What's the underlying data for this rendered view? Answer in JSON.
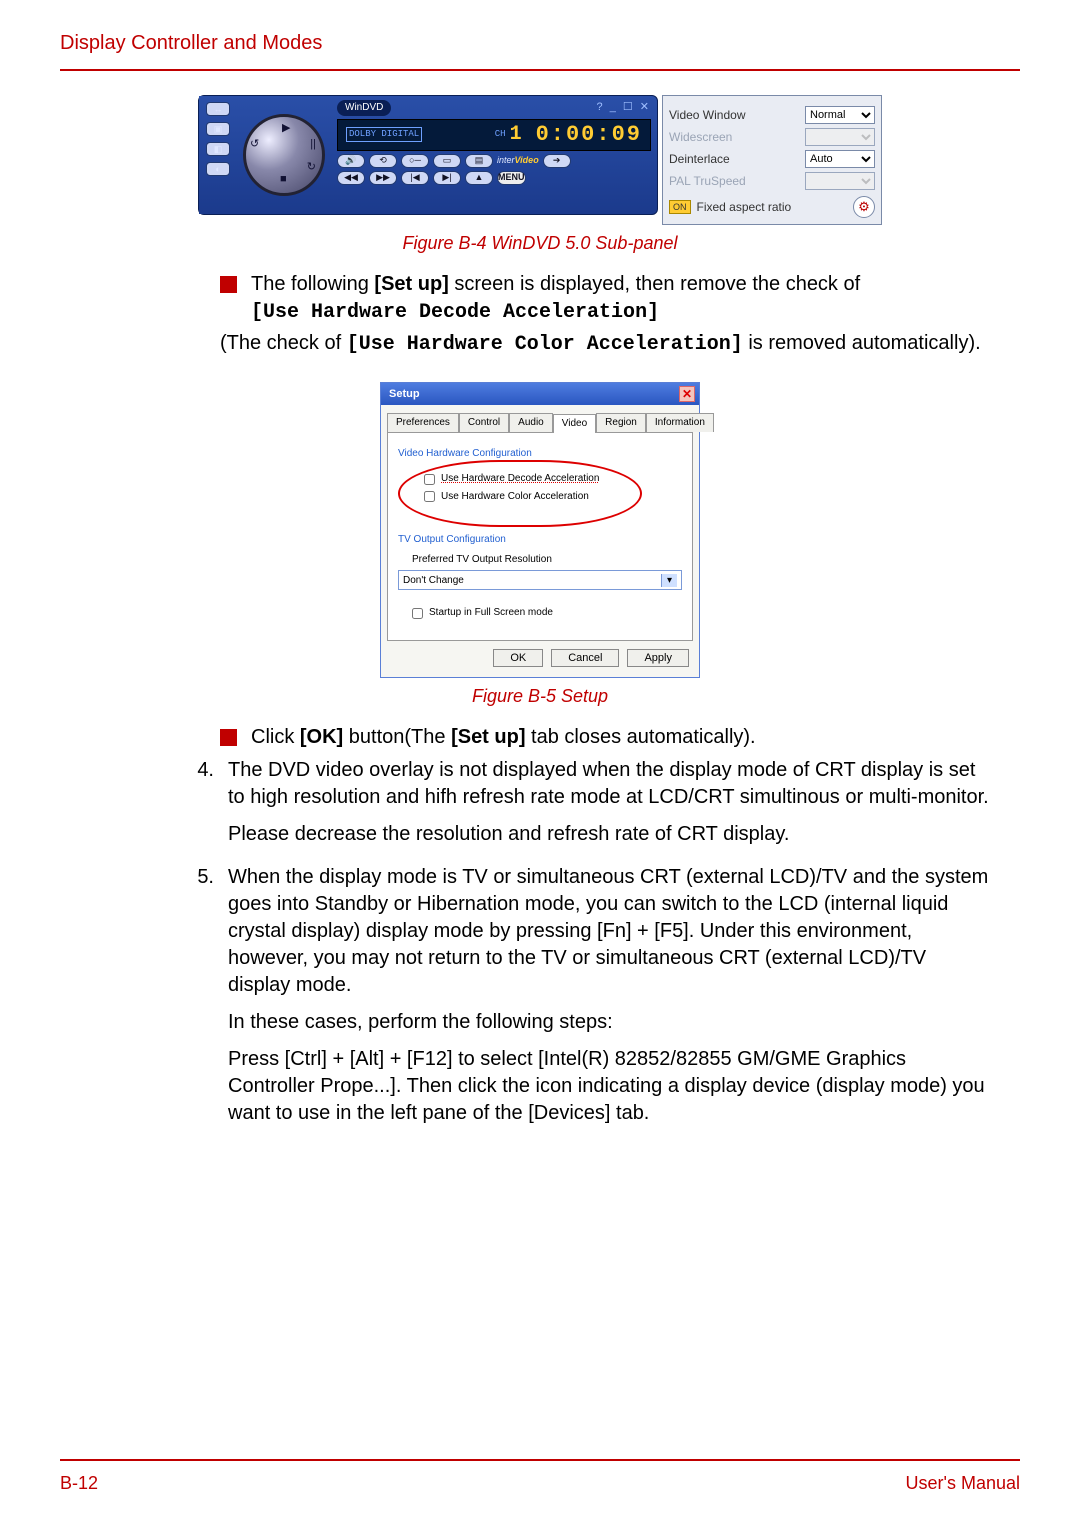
{
  "header": {
    "title": "Display Controller and Modes"
  },
  "windvd": {
    "brand": "WinDVD",
    "title_icons": "? _ ☐ ✕",
    "dolby": "DOLBY DIGITAL",
    "ch_label": "CH",
    "ch_num": "1",
    "time": "0:00:09",
    "intervideo_pre": "inter",
    "intervideo_bold": "Video",
    "menu_label": "MENU",
    "row1": [
      "⟲",
      "○─",
      "▭",
      "▤"
    ],
    "row2": [
      "◀◀",
      "▶▶",
      "|◀",
      "▶|",
      "▲"
    ],
    "dial_marks": [
      "▶",
      "||",
      "■",
      "↺",
      "↻"
    ],
    "side": [
      "↔",
      "▣",
      "◧",
      "◐"
    ]
  },
  "settings": {
    "rows": [
      {
        "label": "Video Window",
        "value": "Normal",
        "disabled": false
      },
      {
        "label": "Widescreen",
        "value": "",
        "disabled": true
      },
      {
        "label": "Deinterlace",
        "value": "Auto",
        "disabled": false
      },
      {
        "label": "PAL TruSpeed",
        "value": "",
        "disabled": true
      }
    ],
    "aspect_on": "ON",
    "aspect_label": "Fixed aspect ratio",
    "gear": "⚙"
  },
  "figcap1": "Figure B-4 WinDVD 5.0 Sub-panel",
  "para1": {
    "pre": "The following ",
    "bold1": "[Set up]",
    "mid": " screen is displayed, then remove the check of ",
    "mono": "[Use Hardware Decode Acceleration]"
  },
  "para2": {
    "pre": "(The check of ",
    "mono": "[Use Hardware Color Acceleration]",
    "post": " is removed automatically)."
  },
  "setup": {
    "title": "Setup",
    "tabs": [
      "Preferences",
      "Control",
      "Audio",
      "Video",
      "Region",
      "Information"
    ],
    "active_tab_index": 3,
    "vhc_label": "Video Hardware Configuration",
    "chk_decode": "Use Hardware Decode Acceleration",
    "chk_color": "Use Hardware Color Acceleration",
    "tv_label": "TV Output Configuration",
    "tv_pref": "Preferred TV Output Resolution",
    "tv_value": "Don't Change",
    "chk_full": "Startup in Full Screen mode",
    "ok": "OK",
    "cancel": "Cancel",
    "apply": "Apply"
  },
  "figcap2": "Figure B-5 Setup",
  "bullet2": {
    "pre": "Click ",
    "b1": "[OK]",
    "mid": " button(The ",
    "b2": "[Set up]",
    "post": " tab closes automatically)."
  },
  "item4": {
    "num": "4.",
    "p1": "The DVD video overlay is not displayed when the display mode of CRT display is set to high resolution and hifh refresh rate mode at LCD/CRT simultinous or multi-monitor.",
    "p2": "Please decrease the resolution and refresh rate of CRT display."
  },
  "item5": {
    "num": "5.",
    "p1": "When the display mode is TV or simultaneous CRT (external LCD)/TV and the system goes into Standby or Hibernation mode, you can switch to the LCD (internal liquid crystal display) display mode by pressing [Fn] + [F5]. Under this environment, however, you may not return to the TV or simultaneous CRT (external LCD)/TV display mode.",
    "p2": "In these cases, perform the following steps:",
    "p3": "Press [Ctrl] + [Alt] + [F12] to select [Intel(R) 82852/82855 GM/GME Graphics Controller Prope...]. Then click the icon indicating a display device (display mode) you want to use in the left pane of the [Devices] tab."
  },
  "footer": {
    "left": "B-12",
    "right": "User's Manual"
  }
}
